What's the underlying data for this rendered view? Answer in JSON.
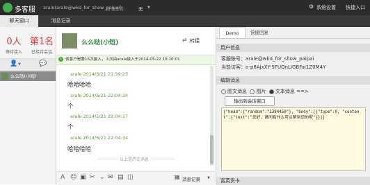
{
  "topbar": {
    "app_name": "多客服",
    "account": "arale(arale@wkd_for_show_paipai)",
    "status_label": "自动应答:",
    "status_value": "无",
    "settings": "系统设置",
    "switch_entry": "快捷入口"
  },
  "tabs": {
    "chat_window": "聊天窗口",
    "messages": "消息记录"
  },
  "left": {
    "waiting_count": "0人",
    "waiting_label": "等待接入",
    "received_count": "第1名",
    "received_label": "已接待会话",
    "contact_name": "么么哒(小短)"
  },
  "chat": {
    "contact_name": "么么哒(小短)",
    "transfer_label": "转接",
    "notice": "该客户是第16次接入，上次由arale接入于2014-05-22 10:10:01",
    "messages": [
      {
        "meta": "arale 2014/5/21 21:39:25",
        "text": "哈哈哈哈"
      },
      {
        "meta": "arale 2014/5/21 22:04:14",
        "text": "个"
      },
      {
        "meta": "arale 2014/5/21 22:04:17",
        "text": "个"
      },
      {
        "meta": "arale 2014/5/21 22:04:34",
        "text": "哈哈哈哈"
      }
    ],
    "history_link": "以上是历史消息",
    "record_label": "消息记录"
  },
  "right": {
    "tab_demo": "Demo",
    "tab_reply": "快捷回复",
    "user_info_title": "用户信息",
    "account_line": "客服账号：arale@wkd_for_show_paipai",
    "visitor_line": "当前访客：o-p8AjxXY-5FUQnLIGBFai1Z0M4Y",
    "edit_title": "编辑消息",
    "radio_image_text": "图文消息",
    "radio_image": "图片",
    "radio_text": "文本消息 ==>",
    "output_button": "输出到会话窗口",
    "code": "{\"head\":{\"random\":\"2384450\"}, \"body\":[{\"type\":0, \"content\":{\"text\":\"您好，请问有什么可以帮到您的呢\"}}]}",
    "bottom_title": "富英贡卡"
  }
}
